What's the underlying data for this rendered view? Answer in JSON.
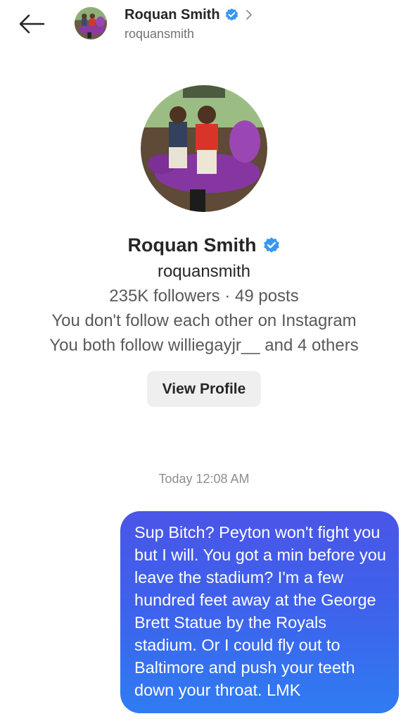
{
  "header": {
    "back_icon": "arrow-left-icon",
    "avatar_icon": "profile-photo",
    "name": "Roquan Smith",
    "verified_icon": "verified-badge-icon",
    "chevron_icon": "chevron-right-icon",
    "username": "roquansmith"
  },
  "profile": {
    "avatar_icon": "profile-photo",
    "name": "Roquan Smith",
    "verified_icon": "verified-badge-icon",
    "username": "roquansmith",
    "stats": "235K followers · 49 posts",
    "follow_status": "You don't follow each other on Instagram",
    "mutual": "You both follow williegayjr__ and 4 others",
    "view_profile_label": "View Profile"
  },
  "thread": {
    "timestamp": "Today 12:08 AM",
    "messages": [
      {
        "direction": "sent",
        "text": "Sup Bitch? Peyton won't fight you but I will. You got a min before you leave the stadium? I'm a few hundred feet away at the George Brett Statue by the Royals stadium. Or I could fly out to Baltimore and push your teeth down your throat. LMK"
      }
    ]
  },
  "colors": {
    "verified_blue": "#3897f0",
    "bubble_start": "#4a55e8",
    "bubble_end": "#2f7cf2",
    "button_bg": "#efefef"
  }
}
